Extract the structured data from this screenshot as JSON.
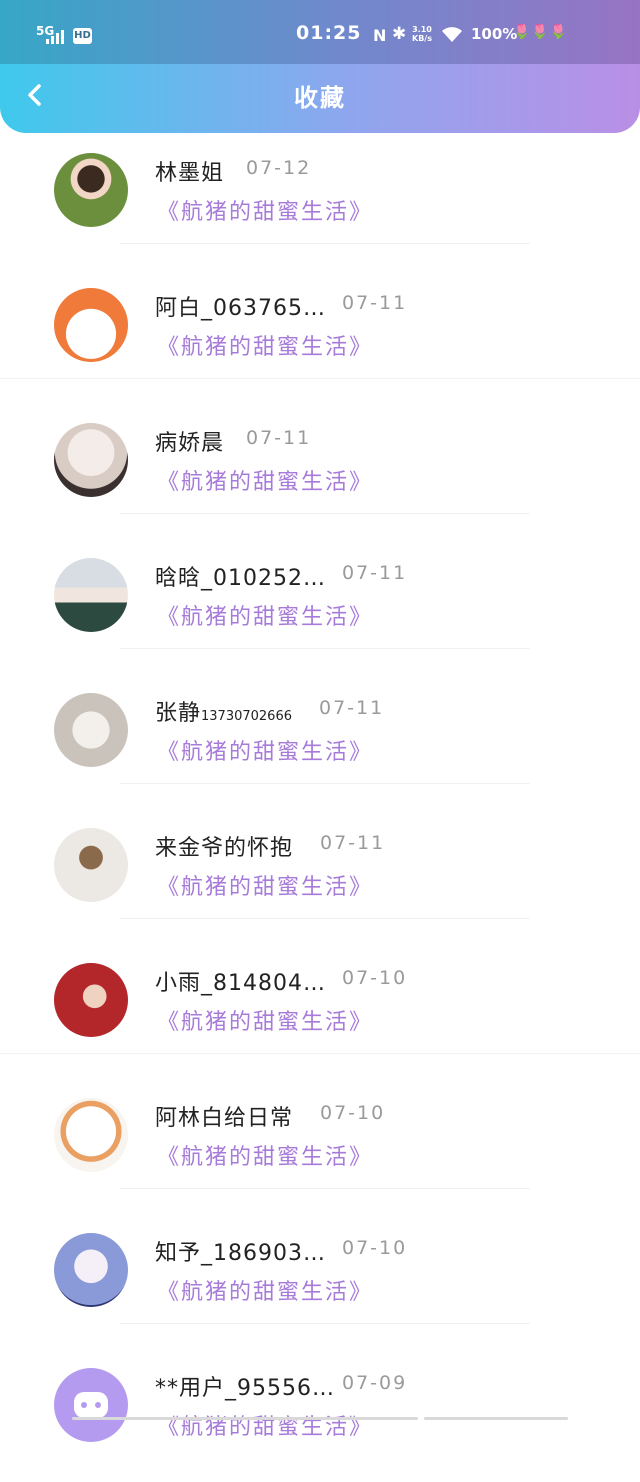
{
  "status_bar": {
    "network": "5G",
    "hd": "HD",
    "time": "01:25",
    "speed_value": "3.10",
    "speed_unit": "KB/s",
    "battery": "100%",
    "icons": [
      "signal-icon",
      "nfc-icon",
      "bluetooth-icon",
      "wifi-icon",
      "tulip-decoration-icon"
    ]
  },
  "header": {
    "back_icon": "chevron-left-icon",
    "title": "收藏"
  },
  "favorites": [
    {
      "name": "林墨姐",
      "date": "07-12",
      "work": "《航猪的甜蜜生活》"
    },
    {
      "name": "阿白_063765…",
      "date": "07-11",
      "work": "《航猪的甜蜜生活》"
    },
    {
      "name": "病娇晨",
      "date": "07-11",
      "work": "《航猪的甜蜜生活》"
    },
    {
      "name": "晗晗_010252…",
      "date": "07-11",
      "work": "《航猪的甜蜜生活》"
    },
    {
      "name": "张静",
      "name_suffix": "13730702666",
      "date": "07-11",
      "work": "《航猪的甜蜜生活》"
    },
    {
      "name": "来金爷的怀抱",
      "date": "07-11",
      "work": "《航猪的甜蜜生活》"
    },
    {
      "name": "小雨_814804…",
      "date": "07-10",
      "work": "《航猪的甜蜜生活》"
    },
    {
      "name": "阿林白给日常",
      "date": "07-10",
      "work": "《航猪的甜蜜生活》"
    },
    {
      "name": "知予_186903…",
      "date": "07-10",
      "work": "《航猪的甜蜜生活》"
    },
    {
      "name": "**用户_95556…",
      "date": "07-09",
      "work": "《航猪的甜蜜生活》"
    }
  ],
  "colors": {
    "header_gradient_start": "#3fc9ec",
    "header_gradient_end": "#b98fe6",
    "work_title": "#a77bd9",
    "date": "#9a9a9a"
  }
}
